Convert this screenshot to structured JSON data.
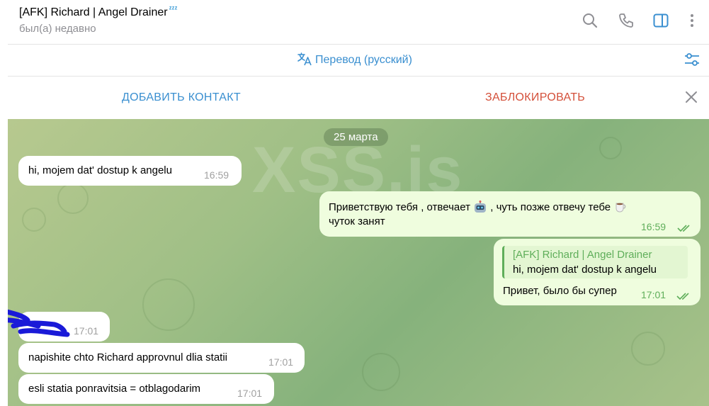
{
  "header": {
    "title": "[AFK] Richard | Angel Drainer",
    "title_emoji": "zzz",
    "status": "был(а) недавно",
    "icons": [
      "search-icon",
      "phone-icon",
      "sidebar-toggle-icon",
      "more-vert-icon"
    ]
  },
  "translate_bar": {
    "label": "Перевод (русский)",
    "icon": "translate-icon",
    "settings_icon": "settings-sliders-icon"
  },
  "action_bar": {
    "add_contact": "ДОБАВИТЬ КОНТАКТ",
    "block": "ЗАБЛОКИРОВАТЬ",
    "close_icon": "close-icon"
  },
  "chat": {
    "watermark": "XSS.is",
    "date": "25 марта",
    "messages": [
      {
        "direction": "in",
        "text": "hi, mojem dat' dostup k angelu",
        "time": "16:59"
      },
      {
        "direction": "out",
        "text_line1_a": "Приветствую тебя , отвечает",
        "text_line1_b": ", чуть позже отвечу тебе",
        "text_line2": "чуток занят",
        "emoji1": "robot",
        "emoji2": "coffee",
        "time": "16:59",
        "read": true
      },
      {
        "direction": "out",
        "reply_name": "[AFK] Richard | Angel Drainer",
        "reply_text": "hi, mojem dat' dostup k angelu",
        "text": "Привет, было бы супер",
        "time": "17:01",
        "read": true
      },
      {
        "direction": "in",
        "text": "",
        "time": "17:01",
        "redacted": true
      },
      {
        "direction": "in",
        "text": "napishite chto Richard approvnul dlia statii",
        "time": "17:01"
      },
      {
        "direction": "in",
        "text": "esli statia ponravitsia = otblagodarim",
        "time": "17:01"
      }
    ]
  },
  "colors": {
    "accent": "#3a8fd0",
    "danger": "#d4503a",
    "outgoing_bubble": "#effdde",
    "read_check": "#5fae5a"
  }
}
